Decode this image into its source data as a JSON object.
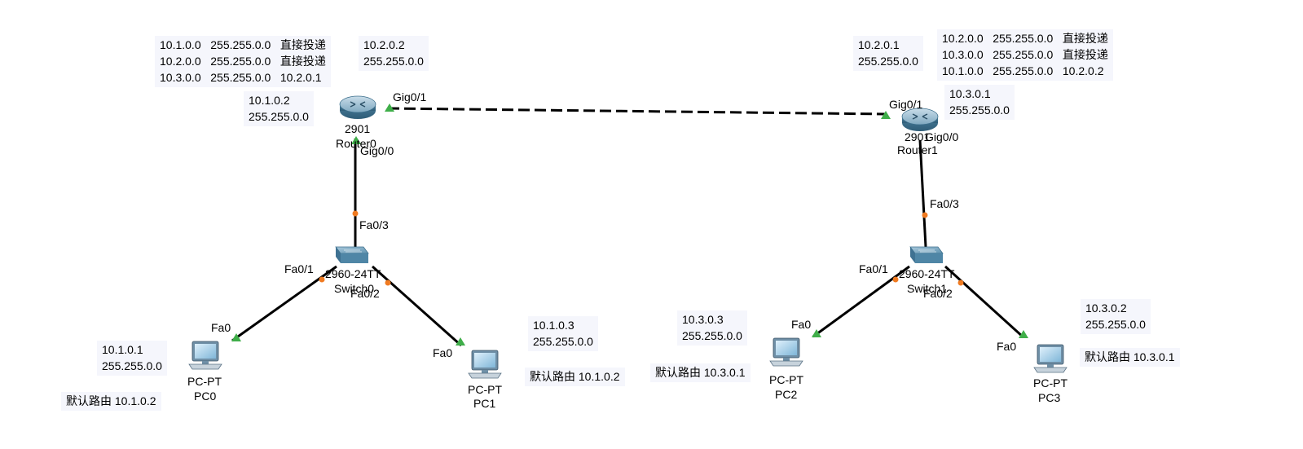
{
  "colors": {
    "cable": "#000000",
    "link_up": "#3fae49",
    "link_orange": "#f07b22",
    "note_bg": "#f5f6fc"
  },
  "devices": {
    "router0": {
      "model": "2901",
      "name": "Router0",
      "icon": "router-icon"
    },
    "router1": {
      "model": "2901",
      "name": "Router1",
      "icon": "router-icon"
    },
    "switch0": {
      "model": "2960-24TT",
      "name": "Switch0",
      "icon": "switch-icon"
    },
    "switch1": {
      "model": "2960-24TT",
      "name": "Switch1",
      "icon": "switch-icon"
    },
    "pc0": {
      "model": "PC-PT",
      "name": "PC0",
      "icon": "pc-icon"
    },
    "pc1": {
      "model": "PC-PT",
      "name": "PC1",
      "icon": "pc-icon"
    },
    "pc2": {
      "model": "PC-PT",
      "name": "PC2",
      "icon": "pc-icon"
    },
    "pc3": {
      "model": "PC-PT",
      "name": "PC3",
      "icon": "pc-icon"
    }
  },
  "ports": {
    "r0_gig01": "Gig0/1",
    "r0_gig00": "Gig0/0",
    "r1_gig01": "Gig0/1",
    "r1_gig00": "Gig0/0",
    "sw0_fa03": "Fa0/3",
    "sw0_fa01": "Fa0/1",
    "sw0_fa02": "Fa0/2",
    "sw1_fa03": "Fa0/3",
    "sw1_fa01": "Fa0/1",
    "sw1_fa02": "Fa0/2",
    "pc0_fa0": "Fa0",
    "pc1_fa0": "Fa0",
    "pc2_fa0": "Fa0",
    "pc3_fa0": "Fa0"
  },
  "notes": {
    "r0_routes": "10.1.0.0   255.255.0.0   直接投递\n10.2.0.0   255.255.0.0   直接投递\n10.3.0.0   255.255.0.0   10.2.0.1",
    "r0_gig01_ip": "10.2.0.2\n255.255.0.0",
    "r0_gig00_ip": "10.1.0.2\n255.255.0.0",
    "r1_gig01_ip": "10.2.0.1\n255.255.0.0",
    "r1_routes": "10.2.0.0   255.255.0.0   直接投递\n10.3.0.0   255.255.0.0   直接投递\n10.1.0.0   255.255.0.0   10.2.0.2",
    "r1_gig00_ip": "10.3.0.1\n255.255.0.0",
    "pc0_ip": "10.1.0.1\n255.255.0.0",
    "pc0_gw": "默认路由 10.1.0.2",
    "pc1_ip": "10.1.0.3\n255.255.0.0",
    "pc1_gw": "默认路由 10.1.0.2",
    "pc2_ip": "10.3.0.3\n255.255.0.0",
    "pc2_gw": "默认路由 10.3.0.1",
    "pc3_ip": "10.3.0.2\n255.255.0.0",
    "pc3_gw": "默认路由 10.3.0.1"
  }
}
